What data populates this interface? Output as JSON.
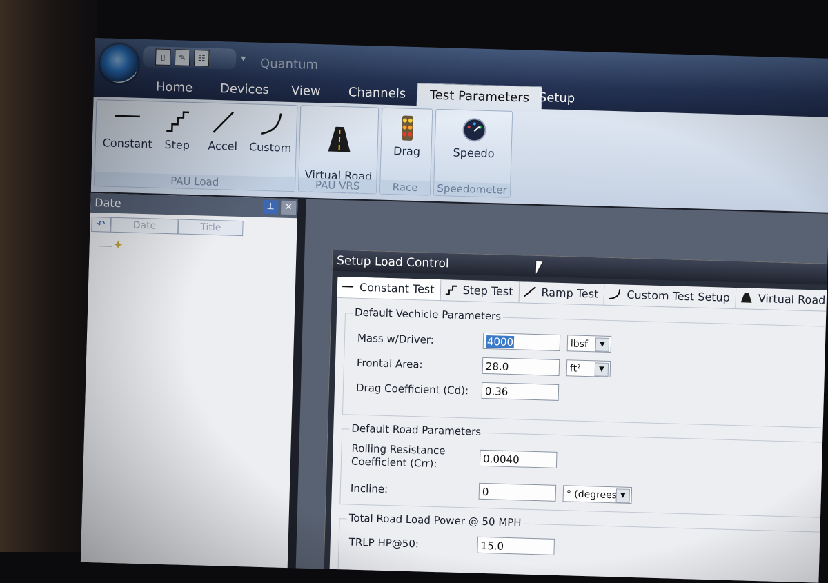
{
  "app": {
    "title": "Quantum"
  },
  "qat": {
    "dropdown_glyph": "▾"
  },
  "tabs": [
    "Home",
    "Devices",
    "View",
    "Channels",
    "Test Parameters",
    "Setup"
  ],
  "ribbon": {
    "groups": [
      {
        "label": "PAU Load",
        "buttons": [
          "Constant",
          "Step",
          "Accel",
          "Custom"
        ]
      },
      {
        "label": "PAU VRS",
        "buttons": [
          "Virtual Road\nSimulation"
        ]
      },
      {
        "label": "Race",
        "buttons": [
          "Drag"
        ]
      },
      {
        "label": "Speedometer",
        "buttons": [
          "Speedo"
        ]
      }
    ]
  },
  "side_panel": {
    "title": "Date",
    "columns": [
      "Date",
      "Title"
    ],
    "pin_glyph": "⊥",
    "close_glyph": "✕",
    "undo_glyph": "↶"
  },
  "dialog": {
    "title": "Setup Load Control",
    "tabs": [
      "Constant Test",
      "Step Test",
      "Ramp Test",
      "Custom Test Setup",
      "Virtual Road S"
    ],
    "vehicle": {
      "legend": "Default Vechicle Parameters",
      "mass_label": "Mass w/Driver:",
      "mass_value": "4000",
      "mass_unit": "lbsf",
      "area_label": "Frontal Area:",
      "area_value": "28.0",
      "area_unit": "ft²",
      "cd_label": "Drag Coefficient (Cd):",
      "cd_value": "0.36"
    },
    "road": {
      "legend": "Default Road Parameters",
      "crr_label_1": "Rolling Resistance",
      "crr_label_2": "Coefficient (Crr):",
      "crr_value": "0.0040",
      "incline_label": "Incline:",
      "incline_value": "0",
      "incline_unit": "° (degrees)"
    },
    "power": {
      "legend": "Total Road Load Power @ 50 MPH",
      "trlp_label": "TRLP HP@50:",
      "trlp_value": "15.0"
    }
  },
  "colors": {
    "accent": "#3a78c8",
    "ribbon": "#dfe7f2",
    "titlebar": "#27365a"
  }
}
